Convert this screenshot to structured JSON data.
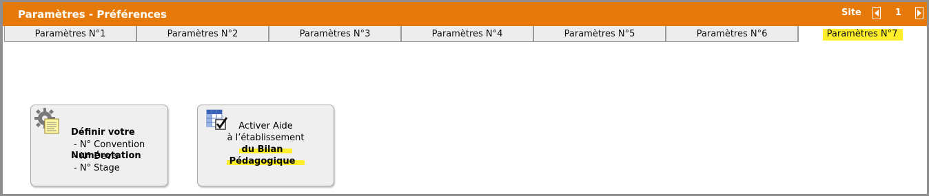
{
  "header": {
    "title": "Paramètres - Préférences",
    "site_label": "Site",
    "page_number": "1",
    "bg_color": "#e57a0a"
  },
  "tabs": [
    {
      "label": "Paramètres N°1",
      "active": false
    },
    {
      "label": "Paramètres N°2",
      "active": false
    },
    {
      "label": "Paramètres N°3",
      "active": false
    },
    {
      "label": "Paramètres N°4",
      "active": false
    },
    {
      "label": "Paramètres N°5",
      "active": false
    },
    {
      "label": "Paramètres N°6",
      "active": false
    },
    {
      "label": "Paramètres N°7",
      "active": true
    }
  ],
  "cards": {
    "numerotation": {
      "icon": "gear-document-icon",
      "title_line1": "Définir votre",
      "title_line2": "Numérotation",
      "items": [
        "-  N° Convention",
        "-  N° Devis",
        "-  N° Stage"
      ]
    },
    "bilan": {
      "icon": "checklist-grid-icon",
      "line1": "Activer Aide",
      "line2": "à l’établissement",
      "line3": "du Bilan",
      "line4": "Pédagogique"
    }
  },
  "colors": {
    "accent": "#e57a0a",
    "highlight": "#ffef2a",
    "tab_bg": "#ededed"
  }
}
